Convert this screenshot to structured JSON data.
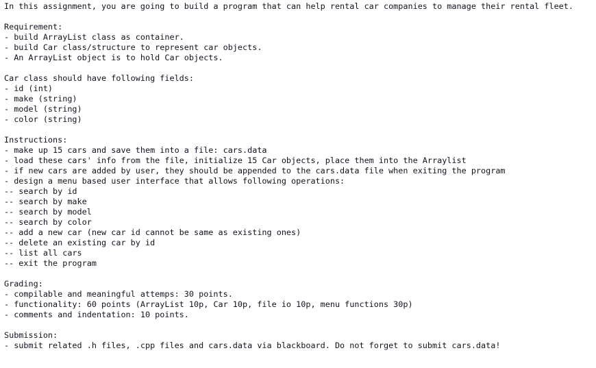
{
  "document": {
    "type": "plain-text-assignment",
    "background_color": "#ffffff",
    "text_color": "#12121f",
    "intro": "In this assignment, you are going to build a program that can help rental car companies to manage their rental fleet.",
    "sections": [
      {
        "heading": "Requirement:",
        "lines": [
          "- build ArrayList class as container.",
          "- build Car class/structure to represent car objects.",
          "- An ArrayList object is to hold Car objects."
        ]
      },
      {
        "heading": "Car class should have following fields:",
        "lines": [
          "- id (int)",
          "- make (string)",
          "- model (string)",
          "- color (string)"
        ]
      },
      {
        "heading": "Instructions:",
        "lines": [
          "- make up 15 cars and save them into a file: cars.data",
          "- load these cars' info from the file, initialize 15 Car objects, place them into the Arraylist",
          "- if new cars are added by user, they should be appended to the cars.data file when exiting the program",
          "- design a menu based user interface that allows following operations:",
          "-- search by id",
          "-- search by make",
          "-- search by model",
          "-- search by color",
          "-- add a new car (new car id cannot be same as existing ones)",
          "-- delete an existing car by id",
          "-- list all cars",
          "-- exit the program"
        ]
      },
      {
        "heading": "Grading:",
        "lines": [
          "- compilable and meaningful attemps: 30 points.",
          "- functionality: 60 points (ArrayList 10p, Car 10p, file io 10p, menu functions 30p)",
          "- comments and indentation: 10 points."
        ]
      },
      {
        "heading": "Submission:",
        "lines": [
          "- submit related .h files, .cpp files and cars.data via blackboard. Do not forget to submit cars.data!"
        ]
      }
    ]
  }
}
